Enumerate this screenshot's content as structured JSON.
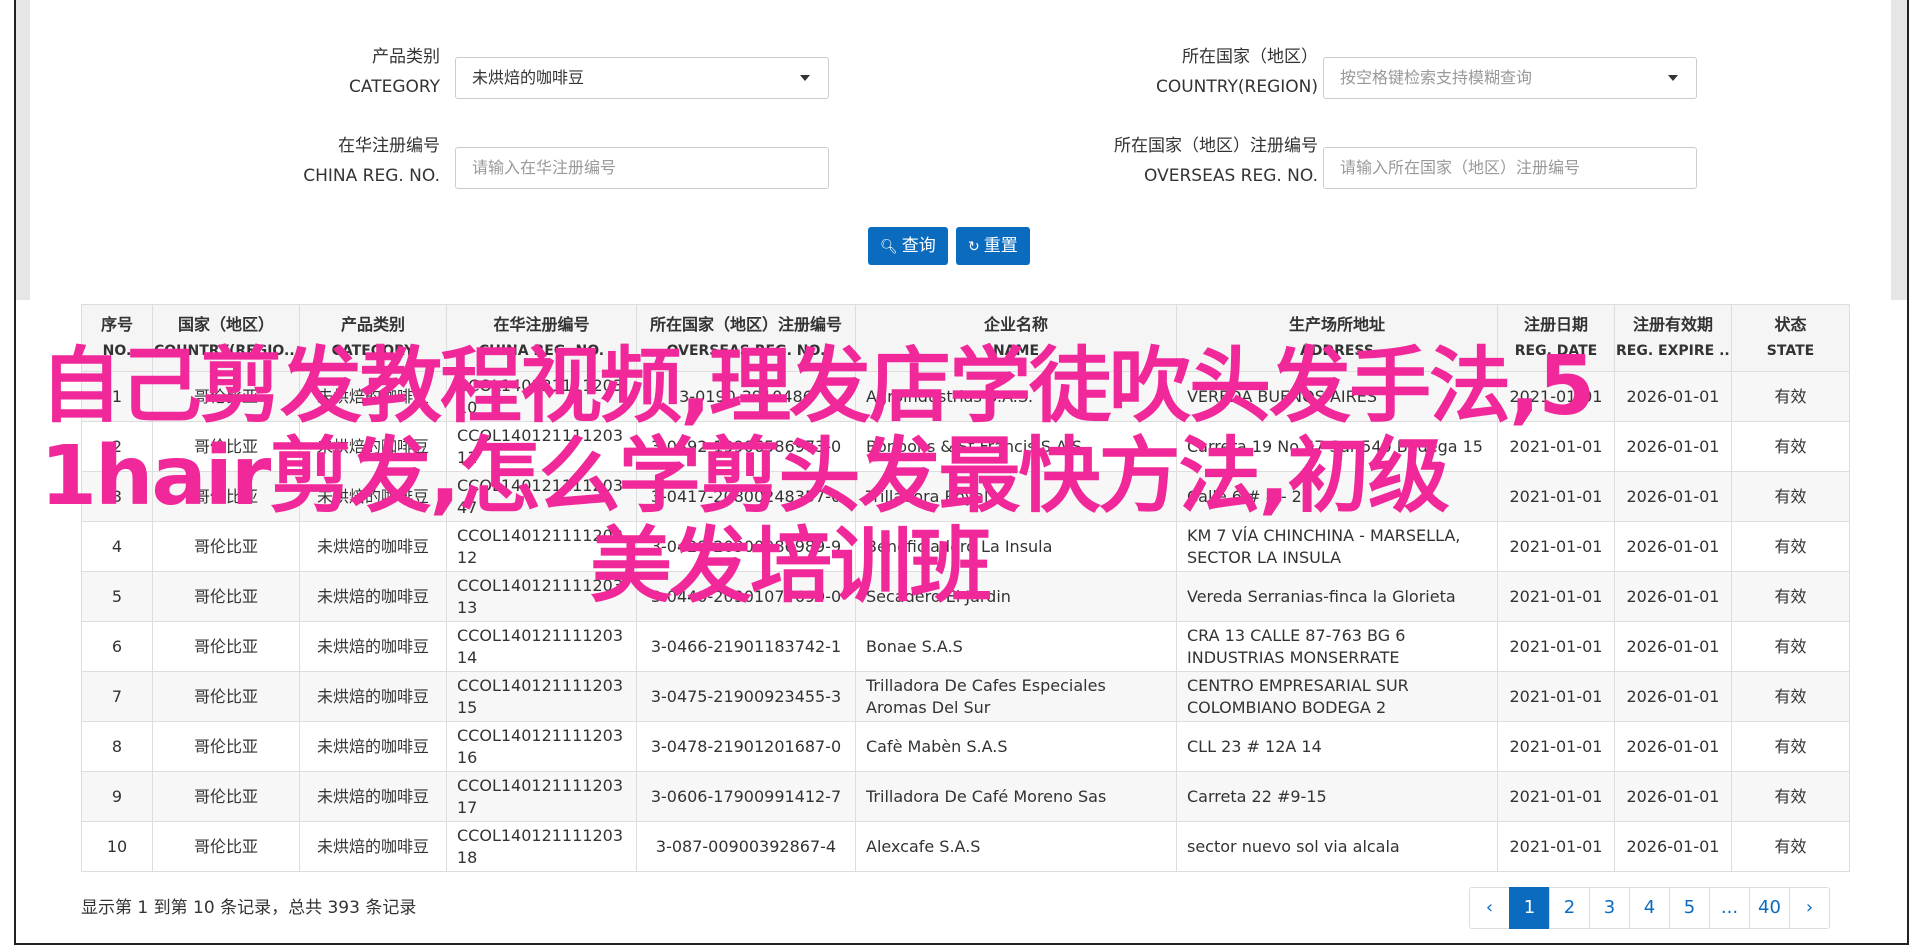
{
  "form": {
    "category": {
      "label_cn": "产品类别",
      "label_en": "CATEGORY",
      "value": "未烘焙的咖啡豆"
    },
    "country": {
      "label_cn": "所在国家（地区）",
      "label_en": "COUNTRY(REGION)",
      "placeholder": "按空格键检索支持模糊查询"
    },
    "china_reg": {
      "label_cn": "在华注册编号",
      "label_en": "CHINA REG. NO.",
      "placeholder": "请输入在华注册编号"
    },
    "overseas_reg": {
      "label_cn": "所在国家（地区）注册编号",
      "label_en": "OVERSEAS REG. NO.",
      "placeholder": "请输入所在国家（地区）注册编号"
    },
    "search_label": "查询",
    "reset_label": "重置"
  },
  "table": {
    "headers": [
      {
        "cn": "序号",
        "en": "NO."
      },
      {
        "cn": "国家（地区）",
        "en": "COUNTRY(REGIO..."
      },
      {
        "cn": "产品类别",
        "en": "CATEGORY"
      },
      {
        "cn": "在华注册编号",
        "en": "CHINA REG. NO."
      },
      {
        "cn": "所在国家（地区）注册编号",
        "en": "OVERSEAS REG. NO."
      },
      {
        "cn": "企业名称",
        "en": "NAME"
      },
      {
        "cn": "生产场所地址",
        "en": "ADDRESS"
      },
      {
        "cn": "注册日期",
        "en": "REG. DATE"
      },
      {
        "cn": "注册有效期",
        "en": "REG. EXPIRE ..."
      },
      {
        "cn": "状态",
        "en": "STATE"
      }
    ],
    "rows": [
      {
        "no": "1",
        "country": "哥伦比亚",
        "category": "未烘焙的咖啡豆",
        "china_reg": "CCOL140121111203 10",
        "overseas_reg": "3-0190-3910486",
        "name": "Agroindustrias S.A.S.",
        "address": "VEREDA BUENOS AIRES",
        "reg_date": "2021-01-01",
        "expire": "2026-01-01",
        "state": "有效"
      },
      {
        "no": "2",
        "country": "哥伦比亚",
        "category": "未烘焙的咖啡豆",
        "china_reg": "CCOL140121111203 11",
        "overseas_reg": "3-0392-19906586973-0",
        "name": "Bonbons & St Francis S.A.S.",
        "address": "Carrera 19 No 67 Sur-540 Bodega 15",
        "reg_date": "2021-01-01",
        "expire": "2026-01-01",
        "state": "有效"
      },
      {
        "no": "3",
        "country": "哥伦比亚",
        "category": "未烘焙的咖啡豆",
        "china_reg": "CCOL140121111203 47",
        "overseas_reg": "3-0417-20800248357-0",
        "name": "Trilladora Royal",
        "address": "Calle 6 # 8 - 28",
        "reg_date": "2021-01-01",
        "expire": "2026-01-01",
        "state": "有效"
      },
      {
        "no": "4",
        "country": "哥伦比亚",
        "category": "未烘焙的咖啡豆",
        "china_reg": "CCOL140121111203 12",
        "overseas_reg": "3-0428-20900986989-9",
        "name": "Beneficiadero La Insula",
        "address": "KM 7 VÍA CHINCHINA - MARSELLA, SECTOR LA INSULA",
        "reg_date": "2021-01-01",
        "expire": "2026-01-01",
        "state": "有效"
      },
      {
        "no": "5",
        "country": "哥伦比亚",
        "category": "未烘焙的咖啡豆",
        "china_reg": "CCOL140121111203 13",
        "overseas_reg": "3-0440-20901077690-0",
        "name": "Secadero El Jardin",
        "address": "Vereda Serranias-finca la Glorieta",
        "reg_date": "2021-01-01",
        "expire": "2026-01-01",
        "state": "有效"
      },
      {
        "no": "6",
        "country": "哥伦比亚",
        "category": "未烘焙的咖啡豆",
        "china_reg": "CCOL140121111203 14",
        "overseas_reg": "3-0466-21901183742-1",
        "name": "Bonae S.A.S",
        "address": "CRA 13 CALLE 87-763 BG 6 INDUSTRIAS MONSERRATE",
        "reg_date": "2021-01-01",
        "expire": "2026-01-01",
        "state": "有效"
      },
      {
        "no": "7",
        "country": "哥伦比亚",
        "category": "未烘焙的咖啡豆",
        "china_reg": "CCOL140121111203 15",
        "overseas_reg": "3-0475-21900923455-3",
        "name": "Trilladora De Cafes Especiales Aromas Del Sur",
        "address": "CENTRO EMPRESARIAL SUR COLOMBIANO BODEGA 2",
        "reg_date": "2021-01-01",
        "expire": "2026-01-01",
        "state": "有效"
      },
      {
        "no": "8",
        "country": "哥伦比亚",
        "category": "未烘焙的咖啡豆",
        "china_reg": "CCOL140121111203 16",
        "overseas_reg": "3-0478-21901201687-0",
        "name": "Cafè Mabèn S.A.S",
        "address": "CLL 23 # 12A 14",
        "reg_date": "2021-01-01",
        "expire": "2026-01-01",
        "state": "有效"
      },
      {
        "no": "9",
        "country": "哥伦比亚",
        "category": "未烘焙的咖啡豆",
        "china_reg": "CCOL140121111203 17",
        "overseas_reg": "3-0606-17900991412-7",
        "name": "Trilladora De Café Moreno Sas",
        "address": "Carreta 22 #9-15",
        "reg_date": "2021-01-01",
        "expire": "2026-01-01",
        "state": "有效"
      },
      {
        "no": "10",
        "country": "哥伦比亚",
        "category": "未烘焙的咖啡豆",
        "china_reg": "CCOL140121111203 18",
        "overseas_reg": "3-087-00900392867-4",
        "name": "Alexcafe S.A.S",
        "address": "sector nuevo sol via alcala",
        "reg_date": "2021-01-01",
        "expire": "2026-01-01",
        "state": "有效"
      }
    ]
  },
  "footer": {
    "summary": "显示第 1 到第 10 条记录，总共 393 条记录"
  },
  "pagination": {
    "prev": "‹",
    "pages": [
      "1",
      "2",
      "3",
      "4",
      "5",
      "...",
      "40"
    ],
    "next": "›",
    "active": "1"
  },
  "overlay": {
    "line1": "自己剪发教程视频,理发店学徒吹头发手法,5",
    "line2": "1hair剪发,怎么学剪头发最快方法,初级",
    "line3": "美发培训班"
  },
  "colors": {
    "primary": "#0b6cbf",
    "overlay": "#f0289a"
  }
}
